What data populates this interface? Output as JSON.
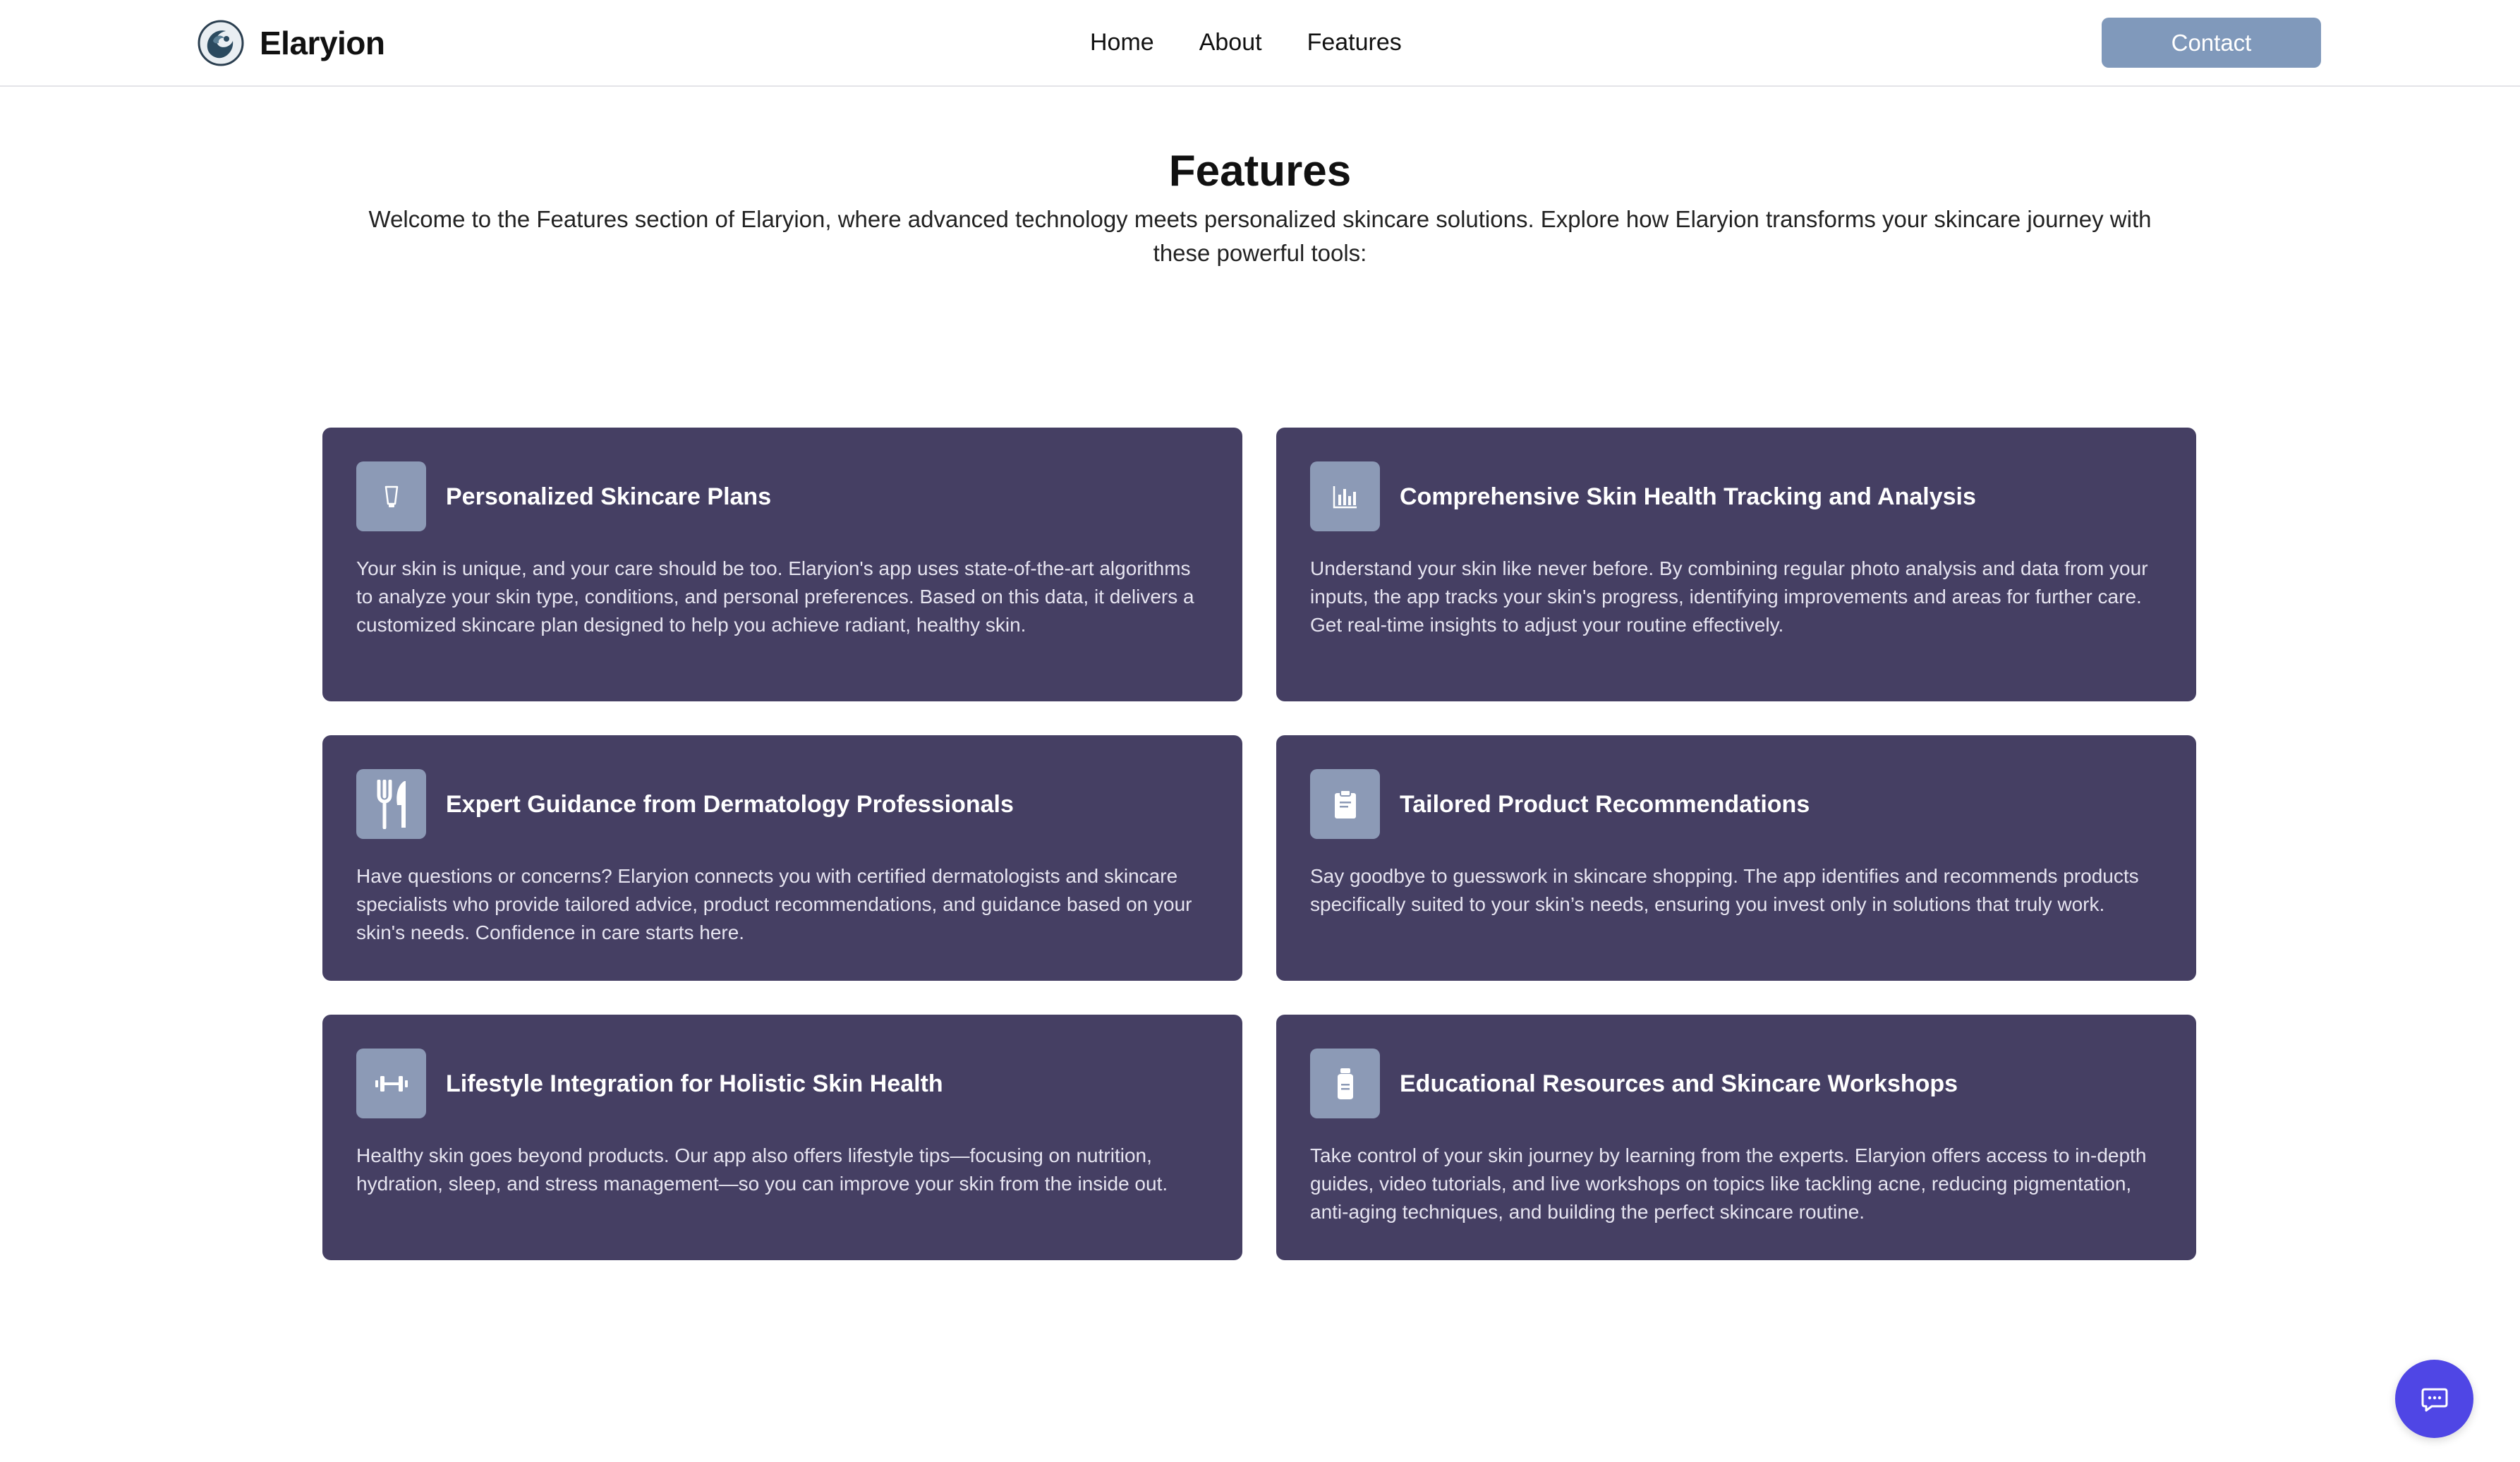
{
  "brand": {
    "name": "Elaryion"
  },
  "nav": {
    "links": [
      "Home",
      "About",
      "Features"
    ],
    "contact_label": "Contact"
  },
  "features": {
    "title": "Features",
    "intro": "Welcome to the Features section of Elaryion, where advanced technology meets personalized skincare solutions. Explore how Elaryion transforms your skincare journey with these powerful tools:",
    "cards": [
      {
        "icon": "skincare-tube-icon",
        "title": "Personalized Skincare Plans",
        "text": "Your skin is unique, and your care should be too. Elaryion's app uses state-of-the-art algorithms to analyze your skin type, conditions, and personal preferences. Based on this data, it delivers a customized skincare plan designed to help you achieve radiant, healthy skin."
      },
      {
        "icon": "chart-icon",
        "title": "Comprehensive Skin Health Tracking and Analysis",
        "text": "Understand your skin like never before. By combining regular photo analysis and data from your inputs, the app tracks your skin's progress, identifying improvements and areas for further care. Get real-time insights to adjust your routine effectively."
      },
      {
        "icon": "utensils-icon",
        "title": "Expert Guidance from Dermatology Professionals",
        "text": "Have questions or concerns? Elaryion connects you with certified dermatologists and skincare specialists who provide tailored advice, product recommendations, and guidance based on your skin's needs. Confidence in care starts here."
      },
      {
        "icon": "clipboard-icon",
        "title": "Tailored Product Recommendations",
        "text": "Say goodbye to guesswork in skincare shopping. The app identifies and recommends products specifically suited to your skin’s needs, ensuring you invest only in solutions that truly work."
      },
      {
        "icon": "dumbbell-icon",
        "title": "Lifestyle Integration for Holistic Skin Health",
        "text": "Healthy skin goes beyond products. Our app also offers lifestyle tips—focusing on nutrition, hydration, sleep, and stress management—so you can improve your skin from the inside out."
      },
      {
        "icon": "bottle-icon",
        "title": "Educational Resources and Skincare Workshops",
        "text": "Take control of your skin journey by learning from the experts. Elaryion offers access to in-depth guides, video tutorials, and live workshops on topics like tackling acne, reducing pigmentation, anti-aging techniques, and building the perfect skincare routine."
      }
    ]
  },
  "chat": {
    "icon": "chat-icon"
  },
  "colors": {
    "card_bg": "#453f63",
    "icon_bg": "#8c9ab6",
    "contact_bg": "#8099bb",
    "chat_bg": "#4f46e5"
  }
}
